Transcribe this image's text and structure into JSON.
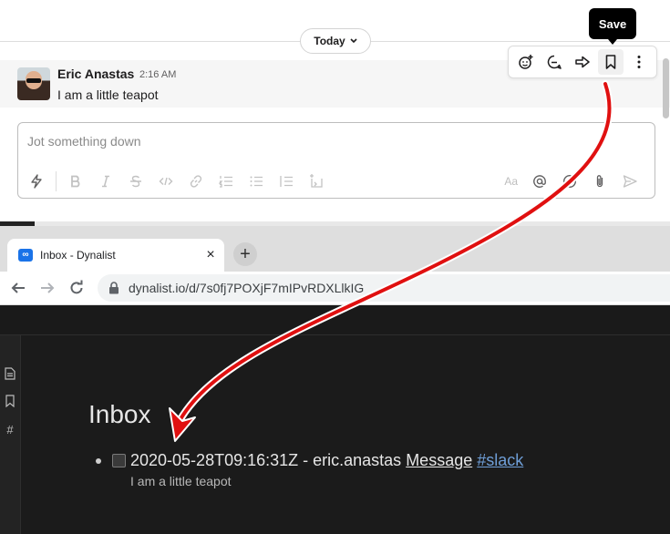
{
  "slack": {
    "date_divider": "Today",
    "message": {
      "author": "Eric Anastas",
      "timestamp": "2:16 AM",
      "text": "I am a little teapot"
    },
    "hover_toolbar": {
      "tooltip": "Save",
      "actions": [
        "add-reaction-icon",
        "reply-in-thread-icon",
        "share-icon",
        "bookmark-icon",
        "more-actions-icon"
      ]
    },
    "composer": {
      "placeholder": "Jot something down",
      "format_label": "Aa"
    }
  },
  "chrome": {
    "tab_title": "Inbox - Dynalist",
    "favicon_glyph": "∞",
    "new_tab_glyph": "+",
    "close_glyph": "×",
    "url": "dynalist.io/d/7s0fj7POXjF7mIPvRDXLlkIG"
  },
  "dynalist": {
    "document_title": "Inbox",
    "item": {
      "text": "2020-05-28T09:16:31Z - eric.anastas ",
      "link_text": "Message",
      "tag": "#slack",
      "note": "I am a little teapot"
    },
    "sidebar_icons": [
      "file-icon",
      "bookmark-icon",
      "tag-icon"
    ],
    "sidebar_tag_glyph": "#"
  },
  "colors": {
    "arrow": "#e01010",
    "dynalist_bg": "#1b1b1b",
    "tag_link": "#6f9fd8",
    "favicon": "#1a73e8"
  }
}
